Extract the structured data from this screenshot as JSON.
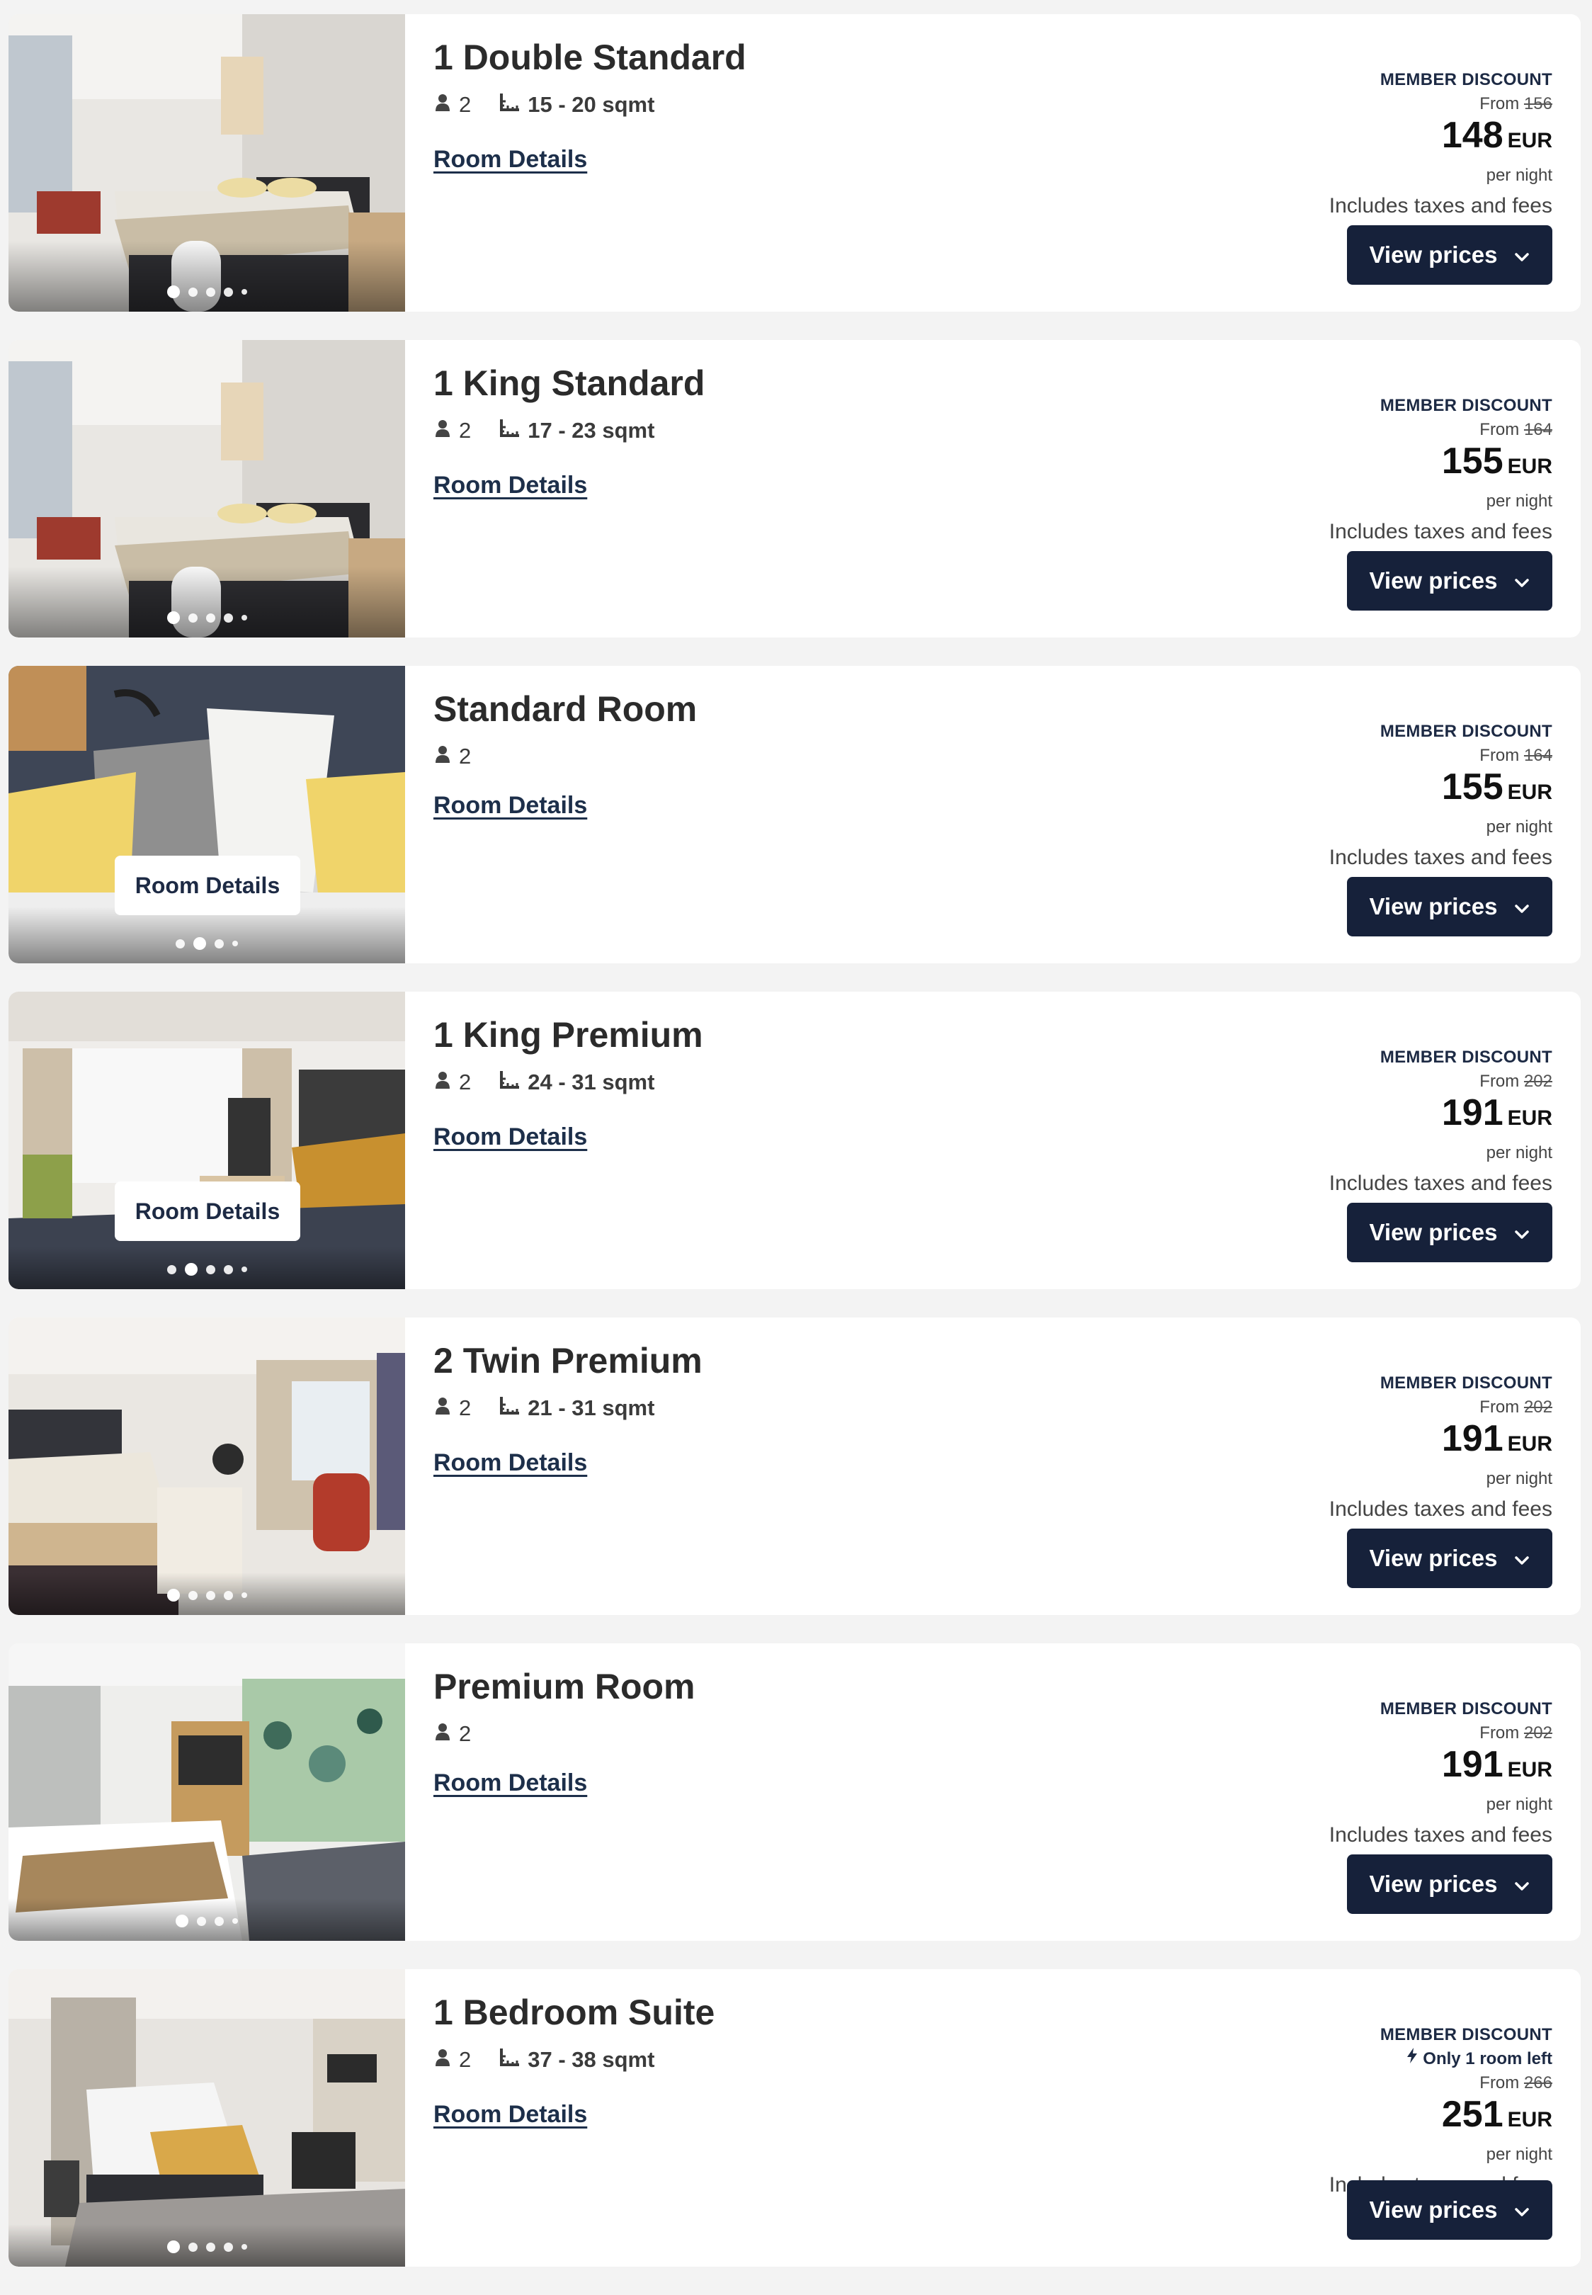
{
  "colors": {
    "page_bg": "#f3f3f3",
    "card_bg": "#ffffff",
    "brand_navy": "#16213a",
    "link": "#1d2f4a"
  },
  "rooms": [
    {
      "title": "1 Double Standard",
      "guests": "2",
      "size": "15 - 20 sqmt",
      "details": "Room Details",
      "discount": "MEMBER DISCOUNT",
      "from": "From",
      "old_price": "156",
      "price": "148",
      "currency": "EUR",
      "per_night": "per night",
      "taxes": "Includes taxes and fees",
      "button": "View prices",
      "dots": 5,
      "active_dot": 1
    },
    {
      "title": "1 King Standard",
      "guests": "2",
      "size": "17 - 23 sqmt",
      "details": "Room Details",
      "discount": "MEMBER DISCOUNT",
      "from": "From",
      "old_price": "164",
      "price": "155",
      "currency": "EUR",
      "per_night": "per night",
      "taxes": "Includes taxes and fees",
      "button": "View prices",
      "dots": 5,
      "active_dot": 1
    },
    {
      "title": "Standard Room",
      "guests": "2",
      "details": "Room Details",
      "photo_button": "Room Details",
      "discount": "MEMBER DISCOUNT",
      "from": "From",
      "old_price": "164",
      "price": "155",
      "currency": "EUR",
      "per_night": "per night",
      "taxes": "Includes taxes and fees",
      "button": "View prices",
      "dots": 4,
      "active_dot": 2
    },
    {
      "title": "1 King Premium",
      "guests": "2",
      "size": "24 - 31 sqmt",
      "details": "Room Details",
      "photo_button": "Room Details",
      "discount": "MEMBER DISCOUNT",
      "from": "From",
      "old_price": "202",
      "price": "191",
      "currency": "EUR",
      "per_night": "per night",
      "taxes": "Includes taxes and fees",
      "button": "View prices",
      "dots": 5,
      "active_dot": 2
    },
    {
      "title": "2 Twin Premium",
      "guests": "2",
      "size": "21 - 31 sqmt",
      "details": "Room Details",
      "discount": "MEMBER DISCOUNT",
      "from": "From",
      "old_price": "202",
      "price": "191",
      "currency": "EUR",
      "per_night": "per night",
      "taxes": "Includes taxes and fees",
      "button": "View prices",
      "dots": 5,
      "active_dot": 1
    },
    {
      "title": "Premium Room",
      "guests": "2",
      "details": "Room Details",
      "discount": "MEMBER DISCOUNT",
      "from": "From",
      "old_price": "202",
      "price": "191",
      "currency": "EUR",
      "per_night": "per night",
      "taxes": "Includes taxes and fees",
      "button": "View prices",
      "dots": 4,
      "active_dot": 1
    },
    {
      "title": "1 Bedroom Suite",
      "guests": "2",
      "size": "37 - 38 sqmt",
      "details": "Room Details",
      "discount": "MEMBER DISCOUNT",
      "availability": "Only 1 room left",
      "from": "From",
      "old_price": "266",
      "price": "251",
      "currency": "EUR",
      "per_night": "per night",
      "taxes": "Includes taxes and fees",
      "button": "View prices",
      "dots": 5,
      "active_dot": 1
    }
  ]
}
